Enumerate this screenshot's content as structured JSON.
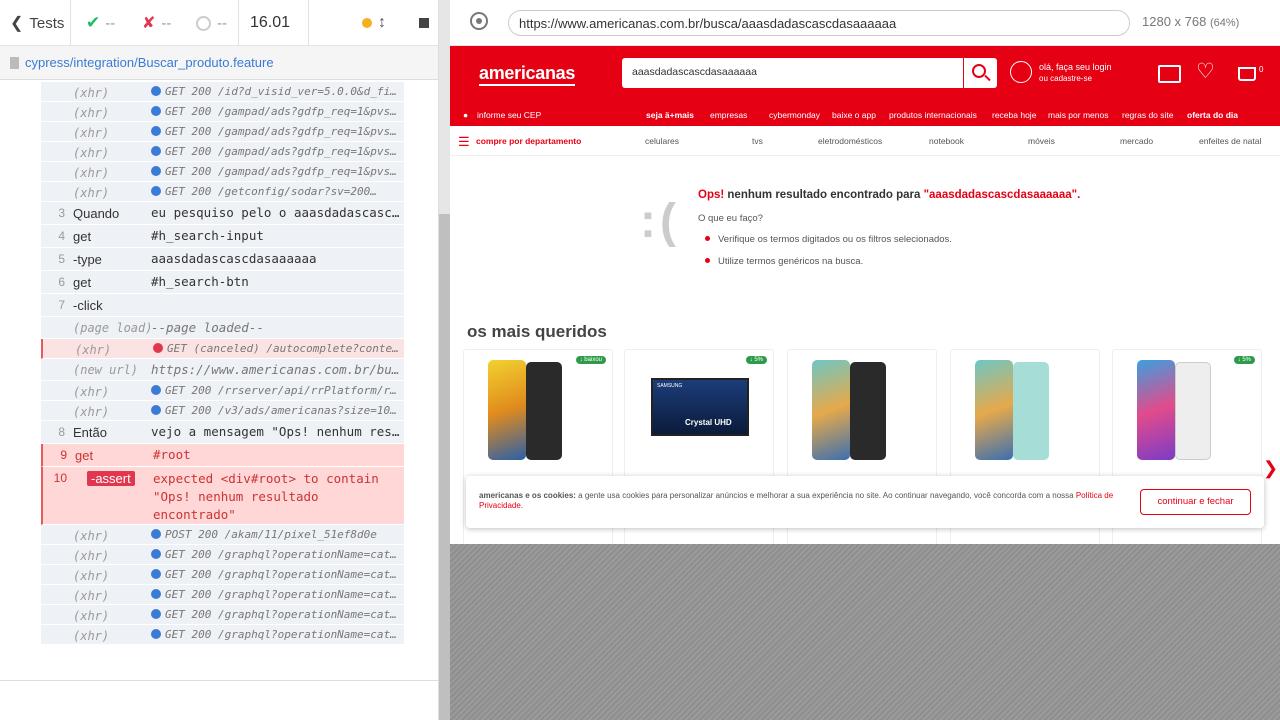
{
  "reporter": {
    "tests_label": "Tests",
    "passed": "--",
    "failed": "--",
    "pending": "--",
    "duration": "16.01",
    "spec_path": "cypress/integration/Buscar_produto.feature",
    "commands": [
      {
        "type": "xhr",
        "name": "(xhr)",
        "msg": "GET 200 /id?d_visid_ver=5.0.0&d_field…"
      },
      {
        "type": "xhr",
        "name": "(xhr)",
        "msg": "GET 200 /gampad/ads?gdfp_req=1&pvsid=…"
      },
      {
        "type": "xhr",
        "name": "(xhr)",
        "msg": "GET 200 /gampad/ads?gdfp_req=1&pvsid=…"
      },
      {
        "type": "xhr",
        "name": "(xhr)",
        "msg": "GET 200 /gampad/ads?gdfp_req=1&pvsid=…"
      },
      {
        "type": "xhr",
        "name": "(xhr)",
        "msg": "GET 200 /gampad/ads?gdfp_req=1&pvsid=…"
      },
      {
        "type": "xhr",
        "name": "(xhr)",
        "msg": "GET 200 /getconfig/sodar?sv=200…"
      },
      {
        "type": "step",
        "num": "3",
        "name": "Quando",
        "msg": "eu pesquiso pelo o aaasdadascascd…"
      },
      {
        "type": "step",
        "num": "4",
        "name": "get",
        "msg": "#h_search-input"
      },
      {
        "type": "step",
        "num": "5",
        "name": "-type",
        "msg": "aaasdadascascdasaaaaaa"
      },
      {
        "type": "step",
        "num": "6",
        "name": "get",
        "msg": "#h_search-btn"
      },
      {
        "type": "step",
        "num": "7",
        "name": "-click",
        "msg": ""
      },
      {
        "type": "meta",
        "name": "(page load)",
        "msg": "--page loaded--"
      },
      {
        "type": "xhr",
        "name": "(xhr)",
        "msg": "GET (canceled) /autocomplete?content=…",
        "fail": true
      },
      {
        "type": "meta",
        "name": "(new url)",
        "msg": "https://www.americanas.com.br/bus…"
      },
      {
        "type": "xhr",
        "name": "(xhr)",
        "msg": "GET 200 /rrserver/api/rrPlatform/recs…"
      },
      {
        "type": "xhr",
        "name": "(xhr)",
        "msg": "GET 200 /v3/ads/americanas?size=10&ui…"
      },
      {
        "type": "step",
        "num": "8",
        "name": "Então",
        "msg": "vejo a mensagem \"Ops! nenhum resu…"
      },
      {
        "type": "fail",
        "num": "9",
        "name": "get",
        "msg": "#root"
      },
      {
        "type": "assert",
        "num": "10",
        "name": "-assert",
        "msg": "expected <div#root> to contain \"Ops! nenhum resultado encontrado\""
      },
      {
        "type": "xhr",
        "name": "(xhr)",
        "msg": "POST 200 /akam/11/pixel_51ef8d0e"
      },
      {
        "type": "xhr",
        "name": "(xhr)",
        "msg": "GET 200 /graphql?operationName=catalo…"
      },
      {
        "type": "xhr",
        "name": "(xhr)",
        "msg": "GET 200 /graphql?operationName=catalo…"
      },
      {
        "type": "xhr",
        "name": "(xhr)",
        "msg": "GET 200 /graphql?operationName=catalo…"
      },
      {
        "type": "xhr",
        "name": "(xhr)",
        "msg": "GET 200 /graphql?operationName=catalo…"
      },
      {
        "type": "xhr",
        "name": "(xhr)",
        "msg": "GET 200 /graphql?operationName=catalo…"
      }
    ]
  },
  "aut": {
    "url": "https://www.americanas.com.br/busca/aaasdadascascdasaaaaaa",
    "viewport": "1280 x 768",
    "zoom": "(64%)"
  },
  "site": {
    "logo": "americanas",
    "search_value": "aaasdadascascdasaaaaaa",
    "login_line1": "olá, faça seu login",
    "login_line2": "ou cadastre-se",
    "cart_count": "0",
    "cep": "informe seu CEP",
    "top_links": [
      "seja ä+mais",
      "empresas",
      "cybermonday",
      "baixe o app",
      "produtos internacionais",
      "receba hoje",
      "mais por menos",
      "regras do site",
      "oferta do dia"
    ],
    "dept_label": "compre por departamento",
    "categories": [
      "celulares",
      "tvs",
      "eletrodomésticos",
      "notebook",
      "móveis",
      "mercado",
      "enfeites de natal"
    ],
    "sad_face": ":(",
    "ops_prefix": "Ops!",
    "ops_middle": " nenhum resultado encontrado para ",
    "ops_term": "\"aaasdadascascdasaaaaaa\".",
    "what_to_do": "O que eu faço?",
    "tips": [
      "Verifique os termos digitados ou os filtros selecionados.",
      "Utilize termos genéricos na busca."
    ],
    "section_title": "os mais queridos",
    "badges": [
      "↓ baixou",
      "↓ 5%",
      "",
      "",
      "↓ 5%"
    ],
    "tv_brand": "SAMSUNG",
    "tv_label": "Crystal UHD",
    "cookie_bold": "americanas e os cookies:",
    "cookie_text": " a gente usa cookies para personalizar anúncios e melhorar a sua experiência no site. Ao continuar navegando, você concorda com a nossa ",
    "cookie_link": "Política de Privacidade",
    "cookie_btn": "continuar e fechar"
  },
  "colors": {
    "brand": "#e60014",
    "pass": "#1bbf63",
    "fail": "#e0374f",
    "pending": "#f4b01d"
  }
}
